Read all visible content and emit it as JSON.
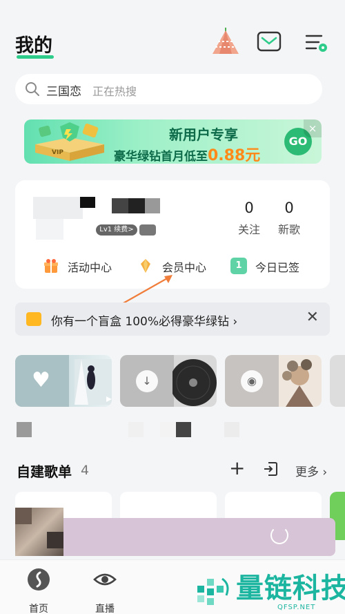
{
  "header": {
    "title": "我的"
  },
  "search": {
    "hot_word": "三国恋",
    "trend_label": "正在热搜"
  },
  "banner": {
    "title": "新用户专享",
    "subtitle": "豪华绿钻首月低至",
    "price": "0.88元",
    "go_label": "GO",
    "close": "×",
    "art_text": "VIP"
  },
  "profile": {
    "level_badge": "Lv1 续费>",
    "stats": [
      {
        "num": "0",
        "label": "关注"
      },
      {
        "num": "0",
        "label": "新歌"
      }
    ],
    "quick_links": [
      {
        "label": "活动中心",
        "icon": "gift-icon",
        "color": "#ff9a3c"
      },
      {
        "label": "会员中心",
        "icon": "diamond-icon",
        "color": "#f5b041"
      },
      {
        "label": "今日已签",
        "icon": "calendar-icon",
        "color": "#5fd3a5",
        "icon_text": "1"
      }
    ]
  },
  "notice": {
    "text": "你有一个盲盒 100%必得豪华绿钻 ›",
    "close": "✕"
  },
  "playlists_section": {
    "title": "自建歌单",
    "count": "4",
    "plus": "+",
    "more": "更多 ›"
  },
  "nav": {
    "items": [
      {
        "label": "首页"
      },
      {
        "label": "直播"
      }
    ]
  },
  "watermark": {
    "name": "量链科技",
    "url": "QFSP.NET"
  },
  "colors": {
    "accent": "#2ecc8a",
    "arrow": "#f07d3a"
  }
}
